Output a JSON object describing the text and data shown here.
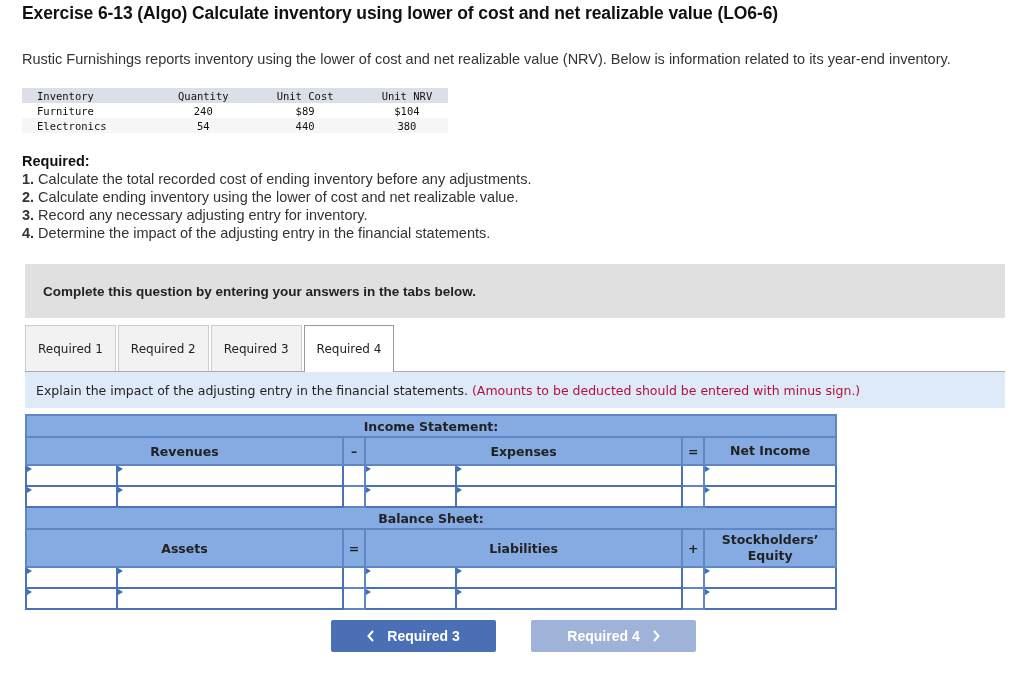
{
  "title": "Exercise 6-13 (Algo) Calculate inventory using lower of cost and net realizable value (LO6-6)",
  "intro": "Rustic Furnishings reports inventory using the lower of cost and net realizable value (NRV). Below is information related to its year-end inventory.",
  "inventory_table": {
    "columns": [
      "Inventory",
      "Quantity",
      "Unit Cost",
      "Unit NRV"
    ],
    "rows": [
      [
        "Furniture",
        "240",
        "$89",
        "$104"
      ],
      [
        "Electronics",
        "54",
        "440",
        "380"
      ]
    ]
  },
  "required": {
    "heading": "Required:",
    "items": [
      {
        "number": "1.",
        "text": "Calculate the total recorded cost of ending inventory before any adjustments."
      },
      {
        "number": "2.",
        "text": "Calculate ending inventory using the lower of cost and net realizable value."
      },
      {
        "number": "3.",
        "text": "Record any necessary adjusting entry for inventory."
      },
      {
        "number": "4.",
        "text": "Determine the impact of the adjusting entry in the financial statements."
      }
    ]
  },
  "banner": "Complete this question by entering your answers in the tabs below.",
  "tabs": [
    {
      "label": "Required 1",
      "selected": false
    },
    {
      "label": "Required 2",
      "selected": false
    },
    {
      "label": "Required 3",
      "selected": false
    },
    {
      "label": "Required 4",
      "selected": true
    }
  ],
  "instruction": {
    "text": "Explain the impact of the adjusting entry in the financial statements.",
    "note": "(Amounts to be deducted should be entered with minus sign.)"
  },
  "sections": [
    {
      "title": "Income Statement:",
      "headers": [
        {
          "kind": "field",
          "label": "Revenues"
        },
        {
          "kind": "operator",
          "label": "–"
        },
        {
          "kind": "field",
          "label": "Expenses"
        },
        {
          "kind": "operator",
          "label": "="
        },
        {
          "kind": "total",
          "label": "Net Income"
        }
      ],
      "rows": [
        {
          "kind": "entry"
        },
        {
          "kind": "entry"
        }
      ]
    },
    {
      "title": "Balance Sheet:",
      "headers": [
        {
          "kind": "field",
          "label": "Assets"
        },
        {
          "kind": "operator",
          "label": "="
        },
        {
          "kind": "field",
          "label": "Liabilities"
        },
        {
          "kind": "operator",
          "label": "+"
        },
        {
          "kind": "total",
          "label": "Stockholders’ Equity"
        }
      ],
      "rows": [
        {
          "kind": "entry"
        },
        {
          "kind": "entry"
        }
      ]
    }
  ],
  "nav": [
    {
      "label": "Required 3",
      "kind": "prev",
      "disabled": false
    },
    {
      "label": "Required 4",
      "kind": "next",
      "disabled": true
    }
  ]
}
